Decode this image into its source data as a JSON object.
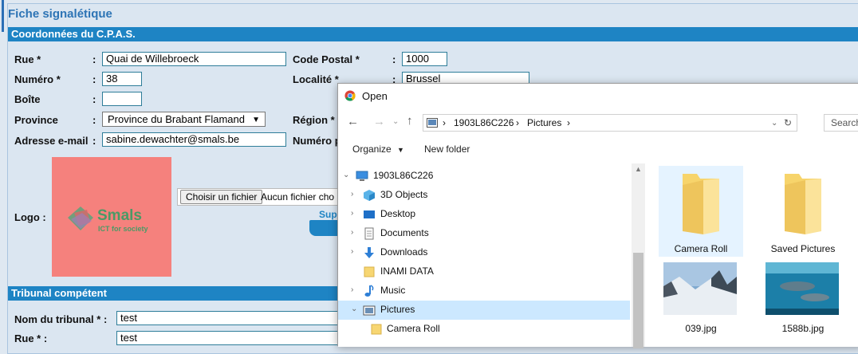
{
  "form": {
    "title": "Fiche signalétique",
    "sections": {
      "cpas": "Coordonnées du C.P.A.S.",
      "tribunal": "Tribunal compétent"
    },
    "fields": {
      "rue_label": "Rue *",
      "rue_value": "Quai de Willebroeck",
      "code_postal_label": "Code Postal *",
      "code_postal_value": "1000",
      "numero_label": "Numéro *",
      "numero_value": "38",
      "localite_label": "Localité *",
      "localite_value": "Brussel",
      "boite_label": "Boîte",
      "boite_value": "",
      "province_label": "Province",
      "province_value": "Province du Brabant Flamand",
      "region_label": "Région *",
      "email_label": "Adresse e-mail",
      "email_value": "sabine.dewachter@smals.be",
      "numero_partial_label": "Numéro p",
      "logo_label": "Logo :",
      "nom_tribunal_label": "Nom du tribunal * :",
      "nom_tribunal_value": "test",
      "rue2_label": "Rue * :",
      "rue2_value": "test"
    },
    "colon": ":",
    "file_button": "Choisir un fichier",
    "file_status": "Aucun fichier cho",
    "sup_text": "Sup",
    "logo": {
      "brand": "Smals",
      "tagline": "ICT for society",
      "bg_color": "#f5817d"
    },
    "accent_color": "#1e84c4"
  },
  "dialog": {
    "title": "Open",
    "icon": "chrome-icon",
    "path": [
      "1903L86C226",
      "Pictures"
    ],
    "search_placeholder": "Search",
    "toolbar": {
      "organize": "Organize",
      "new_folder": "New folder"
    },
    "tree": [
      {
        "label": "1903L86C226",
        "icon": "computer-icon",
        "expanded": true
      },
      {
        "label": "3D Objects",
        "icon": "cube-icon"
      },
      {
        "label": "Desktop",
        "icon": "desktop-icon"
      },
      {
        "label": "Documents",
        "icon": "document-icon"
      },
      {
        "label": "Downloads",
        "icon": "download-icon"
      },
      {
        "label": "INAMI DATA",
        "icon": "folder-icon"
      },
      {
        "label": "Music",
        "icon": "music-icon"
      },
      {
        "label": "Pictures",
        "icon": "pictures-icon",
        "selected": true,
        "expanded": true
      },
      {
        "label": "Camera Roll",
        "icon": "folder-icon"
      }
    ],
    "files": [
      {
        "name": "Camera Roll",
        "type": "folder",
        "highlighted": true
      },
      {
        "name": "Saved Pictures",
        "type": "folder"
      },
      {
        "name": "039.jpg",
        "type": "image"
      },
      {
        "name": "1588b.jpg",
        "type": "image"
      }
    ]
  }
}
